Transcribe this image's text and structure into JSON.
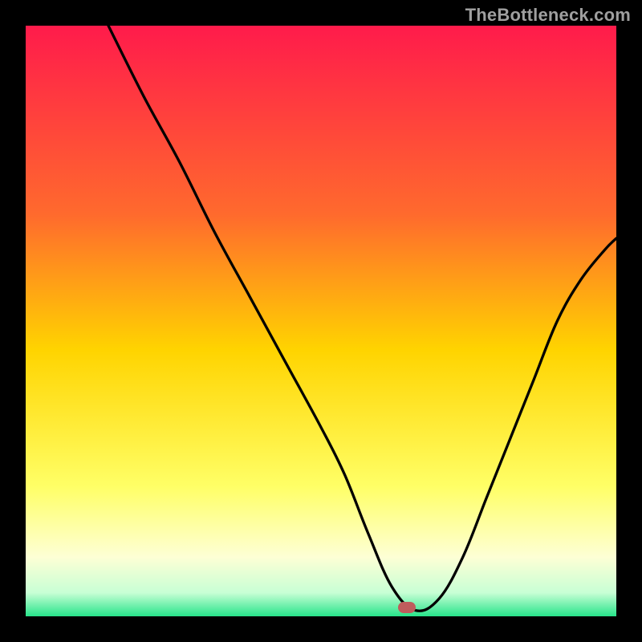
{
  "watermark": "TheBottleneck.com",
  "colors": {
    "top": "#ff1b4b",
    "mid_upper": "#ff8a2d",
    "mid": "#ffd400",
    "mid_lower": "#ffff66",
    "pale": "#fdffd5",
    "green": "#27e48a",
    "marker": "#bf5c5c",
    "line": "#000000"
  },
  "chart_data": {
    "type": "line",
    "title": "",
    "xlabel": "",
    "ylabel": "",
    "xlim": [
      0,
      100
    ],
    "ylim": [
      0,
      100
    ],
    "series": [
      {
        "name": "bottleneck-curve",
        "x": [
          14,
          20,
          26,
          32,
          38,
          44,
          50,
          54,
          58,
          62,
          66,
          70,
          74,
          78,
          82,
          86,
          90,
          94,
          98,
          100
        ],
        "y": [
          100,
          88,
          77,
          65,
          54,
          43,
          32,
          24,
          14,
          5,
          1,
          3,
          10,
          20,
          30,
          40,
          50,
          57,
          62,
          64
        ]
      }
    ],
    "marker": {
      "x": 64.5,
      "y": 1.5
    },
    "gradient_stops": [
      {
        "pct": 0,
        "color": "#ff1b4b"
      },
      {
        "pct": 32,
        "color": "#ff6a2d"
      },
      {
        "pct": 55,
        "color": "#ffd400"
      },
      {
        "pct": 78,
        "color": "#ffff66"
      },
      {
        "pct": 90,
        "color": "#fdffd5"
      },
      {
        "pct": 96,
        "color": "#c8ffd5"
      },
      {
        "pct": 100,
        "color": "#27e48a"
      }
    ]
  }
}
